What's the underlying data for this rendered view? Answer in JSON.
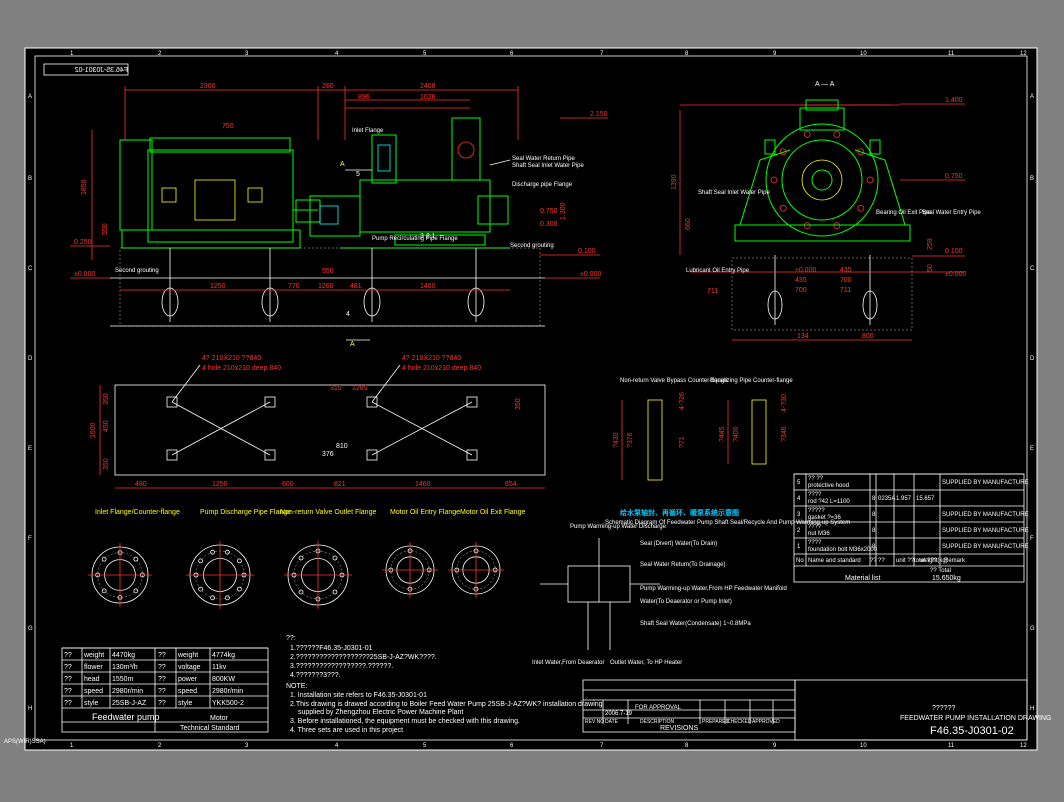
{
  "drawing_no": "F46.35-J0301-02",
  "drawing_no_mirrored": "F46.35-J0301-02",
  "side_tag": "APS(WIR)SSA)",
  "grid_cols": [
    "1",
    "2",
    "3",
    "4",
    "5",
    "6",
    "7",
    "8",
    "9",
    "10",
    "11",
    "12"
  ],
  "grid_rows": [
    "A",
    "B",
    "C",
    "D",
    "E",
    "F",
    "G",
    "H"
  ],
  "top_dims": [
    "2300",
    "260",
    "2408",
    "896",
    "1026",
    "2.150",
    "750",
    "1.400",
    "A — A"
  ],
  "side_dims": [
    "1850",
    "550",
    "0.250",
    "±0.000",
    "1250",
    "770",
    "1260",
    "481",
    "1460",
    "550",
    "0.750",
    "0.300",
    "1.300",
    "0.100",
    "±0.000"
  ],
  "right_dims": [
    "1390",
    "660",
    "0.750",
    "0.100",
    "±0.000",
    "435",
    "435",
    "700",
    "700",
    "711",
    "711",
    "134",
    "800",
    "800",
    "259",
    "50"
  ],
  "plan_dims": [
    "4? 210X210 ??840",
    "4 hole 210x210 deep 840",
    "4? 210X210 ??840",
    "4 hole 210x210 deep 840",
    "1600",
    "350",
    "450",
    "350",
    "480",
    "1250",
    "600",
    "821",
    "1460",
    "654",
    "350",
    "315",
    "1285",
    "810",
    "376",
    "4 hole",
    "?14"
  ],
  "labels_main": [
    "Inlet Flange",
    "Pump Recirculating Pipe Flange",
    "Discharge pipe Flange",
    "Second grouting",
    "Seal Water Return Pipe",
    "Shaft Seal Inlet Water Pipe",
    "Lubricant Oil Entry Pipe",
    "Seal Water Entry Pipe",
    "Bearing Oil Exit Pipe"
  ],
  "flange_titles": [
    "Non-return Valve Bypass Counter-flange",
    "Equalizing Pipe Counter-flange"
  ],
  "flange_dims": [
    "?430",
    "?376",
    "?71",
    "4-?26",
    "?445",
    "?400",
    "?346",
    "4-?30"
  ],
  "section_titles": [
    "Inlet Flange/Counter-flange",
    "Pump Discharge Pipe Flange",
    "Non-return Valve Outlet Flange",
    "Motor Oil Entry Flange",
    "Motor Oil Exit Flange"
  ],
  "schematic_title": "Schematic Diagram Of Feedwater Pump Shaft Seal/Recycle And Pump Warming-up System",
  "schematic_cn": "给水泵轴封、再循环、暖泵系统示意图",
  "schematic_labels": [
    "Pump Warming-up Water Discharge",
    "Seal (Divert) Water(To Drain)",
    "Seal Water Return(To Drainage)",
    "Pump Warming-up Water,From HP Feedwater Manifold",
    "Water(To Deaerator or Pump Inlet)",
    "Shaft Seal Water(Condensate) 1~0.8MPa",
    "Inlet Water,From Deaerator",
    "Outlet Water, To HP Heater"
  ],
  "parts_rows": [
    [
      "5",
      "?? ??",
      "protective hood",
      "",
      "",
      "",
      "",
      "SUPPLIED BY MANUFACTURE"
    ],
    [
      "4",
      "????",
      "rod ?42 L=1100",
      "8",
      "0235A",
      "1.957",
      "15.657",
      ""
    ],
    [
      "3",
      "?????",
      "gasket ?=36",
      "8",
      "",
      "",
      "",
      "SUPPLIED BY MANUFACTURE"
    ],
    [
      "2",
      "????",
      "nut M36",
      "8",
      "",
      "",
      "",
      "SUPPLIED BY MANUFACTURE"
    ],
    [
      "1",
      "????",
      "foundation bolt M36x2000",
      "8",
      "",
      "",
      "",
      "SUPPLIED BY MANUFACTURE"
    ]
  ],
  "parts_header": [
    "No",
    "Name and standard",
    "??",
    "??",
    "unit ??",
    "total ???",
    "weight(kg)",
    "Remark"
  ],
  "material_list": "Material list",
  "total_weight": "15.650kg",
  "total_label": "?? Total",
  "spec_rows": [
    [
      "??",
      "weight",
      "4470kg",
      "??",
      "weight",
      "4774kg"
    ],
    [
      "??",
      "flower",
      "130m³/h",
      "??",
      "voltage",
      "11kv"
    ],
    [
      "??",
      "head",
      "1550m",
      "??",
      "power",
      "800KW"
    ],
    [
      "??",
      "speed",
      "2980r/min",
      "??",
      "speed",
      "2980r/min"
    ],
    [
      "??",
      "style",
      "25SB-J-AZ",
      "??",
      "style",
      "YKK500-2"
    ]
  ],
  "spec_footer_pump": "Feedwater pump",
  "spec_footer_motor": "Motor",
  "spec_footer_std": "Technical Standard",
  "notes_title": "NOTE:",
  "notes": [
    "1. Installation site refers to F46.35-J0301-01",
    "2.This drawing is drawed according to Boiler Feed Water Pump 25SB-J-AZ?WK? installation drawing",
    "supplied by Zhengzhou Electric Power Machine Plant",
    "3. Before installationed, the equipment must be checked with this drawing.",
    "4. Three sets are used in this project"
  ],
  "notes_cn": [
    "1.??????F46.35-J0301-01",
    "2.???????????????????25SB-J-AZ?WK????.",
    "3.??????????????????.??????.",
    "4.???????3???."
  ],
  "revision_label": "REVISIONS",
  "revision_for": "FOR APPROVAL",
  "revision_date": "2006.7-19",
  "revision_cols": [
    "REV NO",
    "DATE",
    "DESCRIPTION",
    "PREPARED",
    "CHECKED",
    "APPROVED"
  ],
  "title_cn": "??????",
  "title_en": "FEEDWATER PUMP INSTALLATION DRAWING",
  "title_no": "F46.35-J0301-02"
}
